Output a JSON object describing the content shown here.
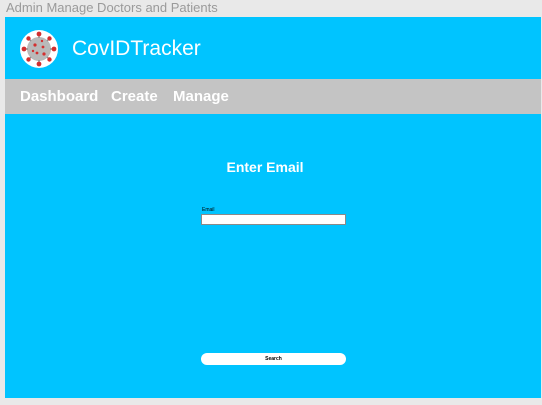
{
  "window": {
    "title": "Admin Manage Doctors and Patients"
  },
  "header": {
    "brand": "CovIDTracker",
    "logo_icon": "coronavirus-icon"
  },
  "nav": {
    "items": [
      {
        "label": "Dashboard"
      },
      {
        "label": "Create"
      },
      {
        "label": "Manage"
      }
    ]
  },
  "main": {
    "heading": "Enter Email",
    "email_label": "Email",
    "email_value": "",
    "search_label": "Search"
  },
  "colors": {
    "primary": "#00c4ff",
    "nav_bar": "#c4c4c4",
    "text_light": "#ffffff",
    "canvas_bg": "#e9e9e9"
  }
}
